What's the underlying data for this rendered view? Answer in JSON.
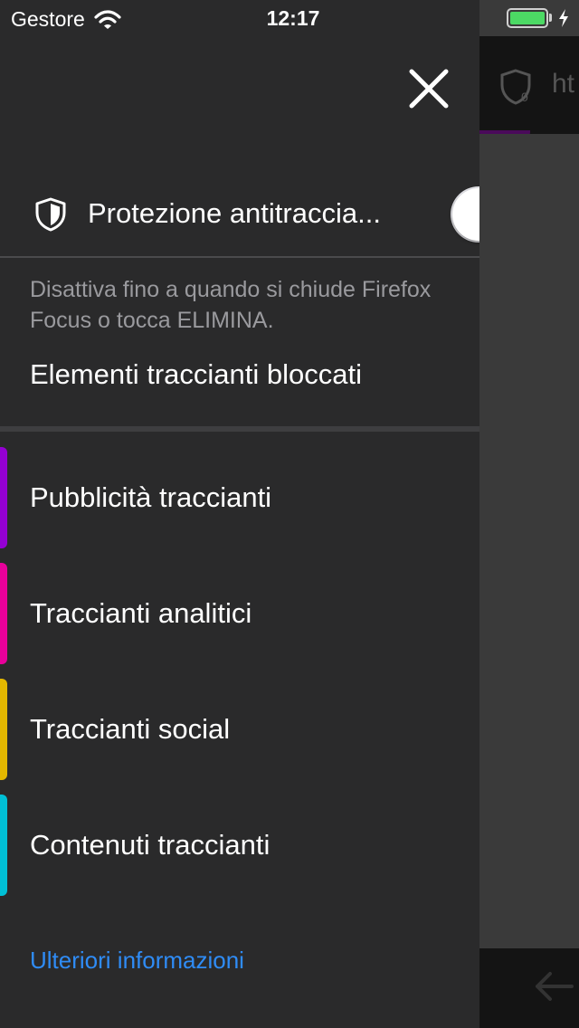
{
  "status_bar": {
    "carrier": "Gestore",
    "time": "12:17",
    "battery_level": 1.0,
    "battery_color": "#4cd964"
  },
  "background": {
    "url_fragment": "ht"
  },
  "drawer": {
    "close_icon": "close-icon",
    "protection": {
      "icon": "shield-icon",
      "label": "Protezione antitraccia...",
      "enabled": true
    },
    "description": "Disattiva fino a quando si chiude Firefox Focus o tocca ELIMINA.",
    "blocked_title": "Elementi traccianti bloccati",
    "trackers": [
      {
        "label": "Pubblicità traccianti",
        "color": "#9400d3"
      },
      {
        "label": "Traccianti analitici",
        "color": "#e8009a"
      },
      {
        "label": "Traccianti social",
        "color": "#e3b700"
      },
      {
        "label": "Contenuti traccianti",
        "color": "#00c0d6"
      }
    ],
    "learn_more": "Ulteriori informazioni",
    "link_color": "#2f8cf6"
  }
}
